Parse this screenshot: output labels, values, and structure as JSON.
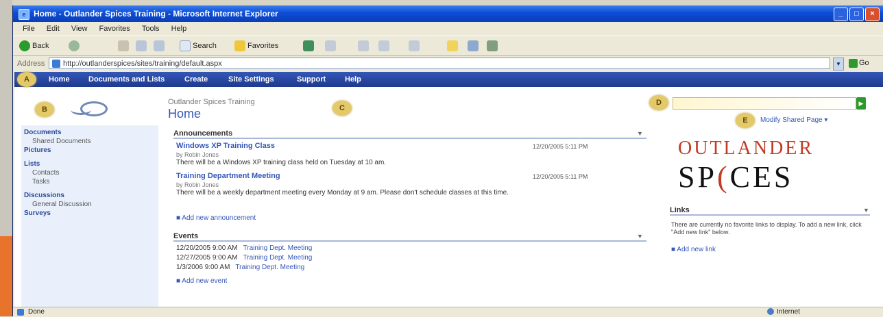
{
  "window": {
    "title": "Home - Outlander Spices Training - Microsoft Internet Explorer",
    "controls": [
      "_",
      "□",
      "×"
    ]
  },
  "menubar": [
    "File",
    "Edit",
    "View",
    "Favorites",
    "Tools",
    "Help"
  ],
  "toolbar": {
    "back": "Back",
    "search": "Search",
    "favorites": "Favorites"
  },
  "address": {
    "label": "Address",
    "url": "http://outlanderspices/sites/training/default.aspx",
    "go": "Go"
  },
  "topnav": [
    "Home",
    "Documents and Lists",
    "Create",
    "Site Settings",
    "Support",
    "Help"
  ],
  "callouts": {
    "a": "A",
    "b": "B",
    "c": "C",
    "d": "D",
    "e": "E"
  },
  "header": {
    "site_title": "Outlander Spices Training",
    "page_title": "Home",
    "my_site_link": "Modify Shared Page ▾"
  },
  "leftnav": {
    "items": [
      {
        "label": "Documents",
        "level": "header"
      },
      {
        "label": "Shared Documents",
        "level": "sub"
      },
      {
        "label": "Pictures",
        "level": "header"
      },
      {
        "label": "Lists",
        "level": "header"
      },
      {
        "label": "Contacts",
        "level": "sub"
      },
      {
        "label": "Tasks",
        "level": "sub"
      },
      {
        "label": "Discussions",
        "level": "header"
      },
      {
        "label": "General Discussion",
        "level": "sub"
      },
      {
        "label": "Surveys",
        "level": "header"
      }
    ]
  },
  "announcements": {
    "title": "Announcements",
    "items": [
      {
        "title": "Windows XP Training Class",
        "by": "by Robin Jones",
        "date": "12/20/2005 5:11 PM",
        "body": "There will be a Windows XP training class held on Tuesday at 10 am."
      },
      {
        "title": "Training Department Meeting",
        "by": "by Robin Jones",
        "date": "12/20/2005 5:11 PM",
        "body": "There will be a weekly department meeting every Monday at 9 am. Please don't schedule classes at this time."
      }
    ],
    "add_link": "Add new announcement"
  },
  "events": {
    "title": "Events",
    "items": [
      {
        "date": "12/20/2005 9:00 AM",
        "title": "Training Dept. Meeting"
      },
      {
        "date": "12/27/2005 9:00 AM",
        "title": "Training Dept. Meeting"
      },
      {
        "date": "1/3/2006 9:00 AM",
        "title": "Training Dept. Meeting"
      }
    ],
    "add_link": "Add new event"
  },
  "brand": {
    "top": "OUTLANDER",
    "bottom_left": "SP",
    "bottom_accent": "(",
    "bottom_right": "CES"
  },
  "links": {
    "title": "Links",
    "body": "There are currently no favorite links to display. To add a new link, click \"Add new link\" below.",
    "add_link": "Add new link"
  },
  "statusbar": {
    "text": "Done",
    "zone": "Internet"
  }
}
